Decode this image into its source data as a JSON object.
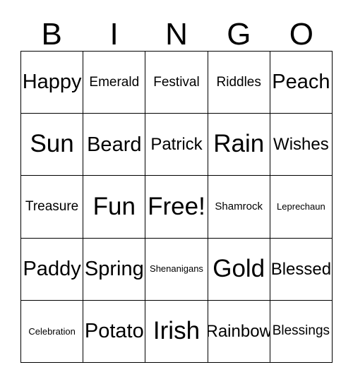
{
  "card": {
    "title": "Bingo Card",
    "header_letters": [
      "B",
      "I",
      "N",
      "G",
      "O"
    ],
    "colors": {
      "background": "#ffffff",
      "text": "#000000",
      "grid_line": "#000000"
    },
    "grid": {
      "columns": 5,
      "rows": 5,
      "free_space": "Free!",
      "rows_data": [
        [
          {
            "label": "Happy",
            "size": "fs-lg"
          },
          {
            "label": "Emerald",
            "size": "fs-sm"
          },
          {
            "label": "Festival",
            "size": "fs-sm"
          },
          {
            "label": "Riddles",
            "size": "fs-sm"
          },
          {
            "label": "Peach",
            "size": "fs-lg"
          }
        ],
        [
          {
            "label": "Sun",
            "size": "fs-xl"
          },
          {
            "label": "Beard",
            "size": "fs-lg"
          },
          {
            "label": "Patrick",
            "size": "fs-md"
          },
          {
            "label": "Rain",
            "size": "fs-xl"
          },
          {
            "label": "Wishes",
            "size": "fs-md"
          }
        ],
        [
          {
            "label": "Treasure",
            "size": "fs-sm"
          },
          {
            "label": "Fun",
            "size": "fs-xl"
          },
          {
            "label": "Free!",
            "size": "fs-xl"
          },
          {
            "label": "Shamrock",
            "size": "fs-xs"
          },
          {
            "label": "Leprechaun",
            "size": "fs-xxs"
          }
        ],
        [
          {
            "label": "Paddy",
            "size": "fs-lg"
          },
          {
            "label": "Spring",
            "size": "fs-lg"
          },
          {
            "label": "Shenanigans",
            "size": "fs-xxs"
          },
          {
            "label": "Gold",
            "size": "fs-xl"
          },
          {
            "label": "Blessed",
            "size": "fs-md"
          }
        ],
        [
          {
            "label": "Celebration",
            "size": "fs-xxs"
          },
          {
            "label": "Potato",
            "size": "fs-lg"
          },
          {
            "label": "Irish",
            "size": "fs-xl"
          },
          {
            "label": "Rainbow",
            "size": "fs-md"
          },
          {
            "label": "Blessings",
            "size": "fs-sm"
          }
        ]
      ]
    }
  }
}
